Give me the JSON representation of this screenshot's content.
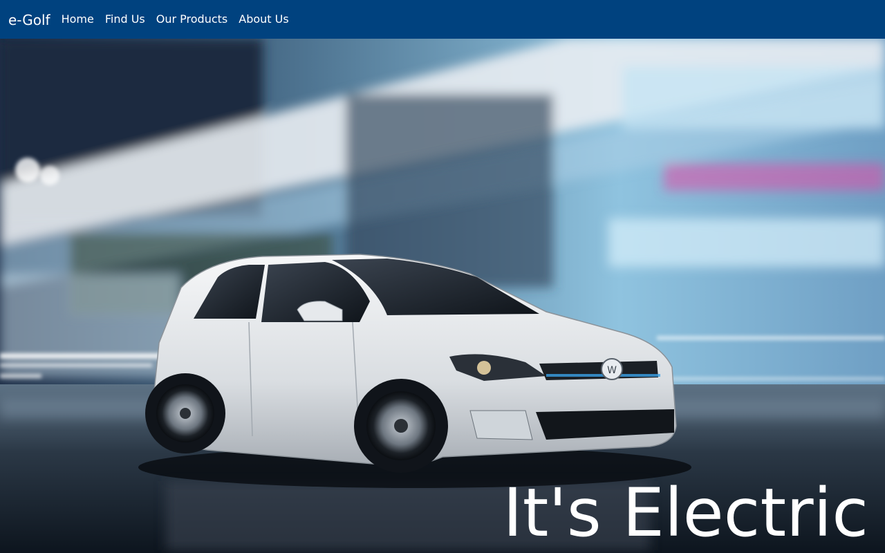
{
  "navbar": {
    "brand": "e-Golf",
    "links": [
      {
        "label": "Home"
      },
      {
        "label": "Find Us"
      },
      {
        "label": "Our Products"
      },
      {
        "label": "About Us"
      }
    ]
  },
  "hero": {
    "tagline": "It's Electric",
    "image": "white-electric-hatchback-city-motion"
  },
  "colors": {
    "navbar_bg": "#00427f",
    "text": "#ffffff"
  }
}
